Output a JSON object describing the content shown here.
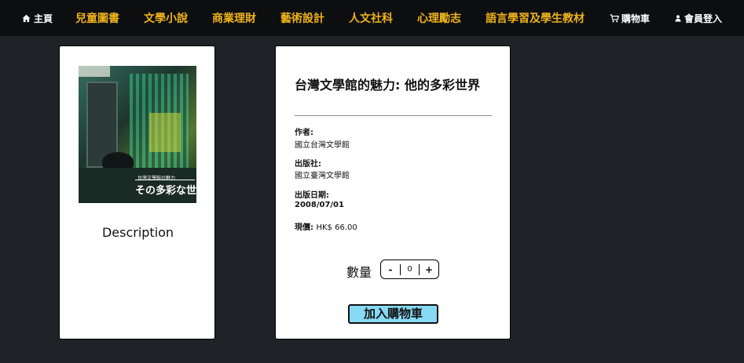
{
  "nav": {
    "home_label": "主頁",
    "categories": [
      "兒童圖書",
      "文學小說",
      "商業理財",
      "藝術設計",
      "人文社科",
      "心理勵志",
      "語言學習及學生教材"
    ],
    "cart_label": "購物車",
    "login_label": "會員登入"
  },
  "left_card": {
    "cover": {
      "subtitle": "台灣文學館の魅力",
      "title": "その多彩な世界"
    },
    "description_label": "Description"
  },
  "product": {
    "title": "台灣文學館的魅力: 他的多彩世界",
    "author_label": "作者:",
    "author": "國立台灣文學館",
    "publisher_label": "出版社:",
    "publisher": "國立臺灣文學館",
    "date_label": "出版日期:",
    "date": "2008/07/01",
    "price_label": "現價:",
    "price": "HK$ 66.00",
    "quantity_label": "數量",
    "minus": "-",
    "quantity": "0",
    "plus": "+",
    "add_to_cart": "加入購物車"
  },
  "colors": {
    "nav_bg": "#0d0e10",
    "page_bg": "#1f2226",
    "category_text": "#f0b419",
    "add_button": "#87d9f4"
  },
  "icons": {
    "home": "home-icon",
    "cart": "cart-icon",
    "user": "user-icon"
  }
}
